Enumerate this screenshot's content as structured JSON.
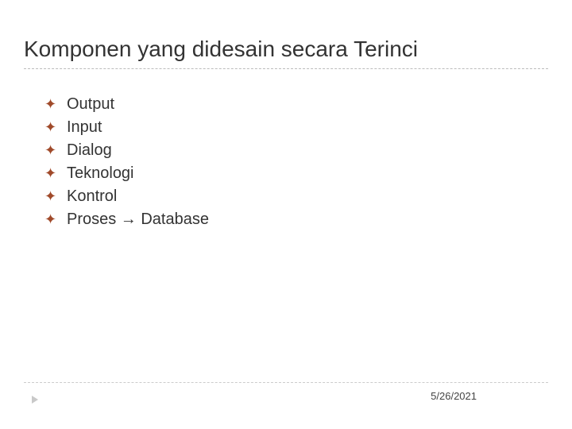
{
  "slide": {
    "title": "Komponen yang didesain secara Terinci",
    "items": [
      "Output",
      "Input",
      "Dialog",
      "Teknologi",
      "Kontrol",
      "Proses → Database"
    ],
    "footer_date": "5/26/2021",
    "bullet_glyph": "✦"
  }
}
